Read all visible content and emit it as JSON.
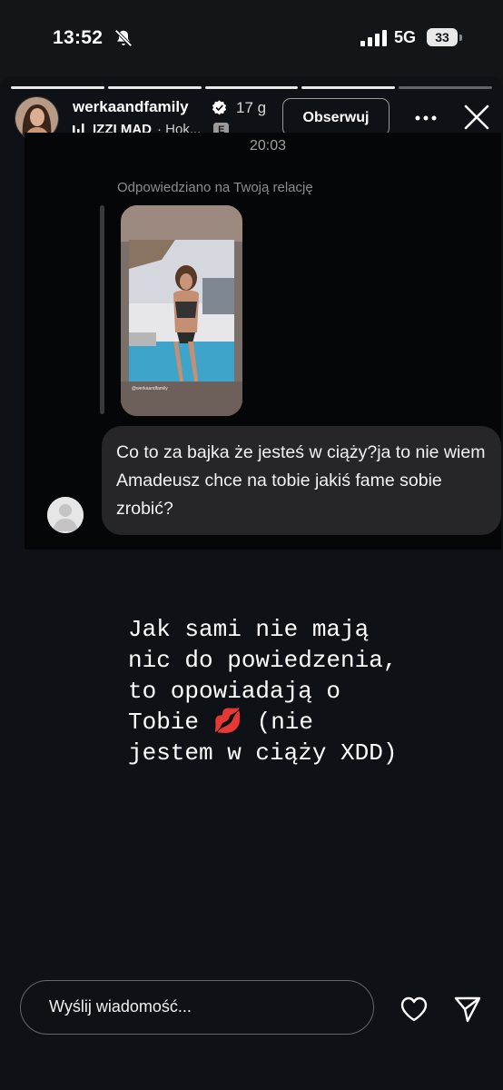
{
  "status_bar": {
    "time": "13:52",
    "network": "5G",
    "battery": "33"
  },
  "story": {
    "progress_done_segments": 4,
    "progress_total_segments": 5,
    "header": {
      "username": "werkaandfamily",
      "age": "17 g",
      "music_title": "IZZI MAD",
      "music_sub": "· Hok...",
      "explicit_badge": "E",
      "follow_label": "Obserwuj"
    },
    "shared_dm": {
      "time": "20:03",
      "replied_label": "Odpowiedziano na Twoją relację",
      "thumb_caption": "@werkaandfamily",
      "message": "Co to za bajka że jesteś w ciąży?ja to nie wiem Amadeusz chce na tobie jakiś fame sobie zrobić?"
    },
    "caption": "Jak sami nie mają\nnic do powiedzenia,\nto opowiadają o\nTobie 💋 (nie\njestem w ciąży XDD)",
    "footer": {
      "reply_placeholder": "Wyślij wiadomość..."
    }
  },
  "colors": {
    "background": "#121417",
    "bubble": "#262628",
    "muted_text": "#8d8d8d"
  }
}
